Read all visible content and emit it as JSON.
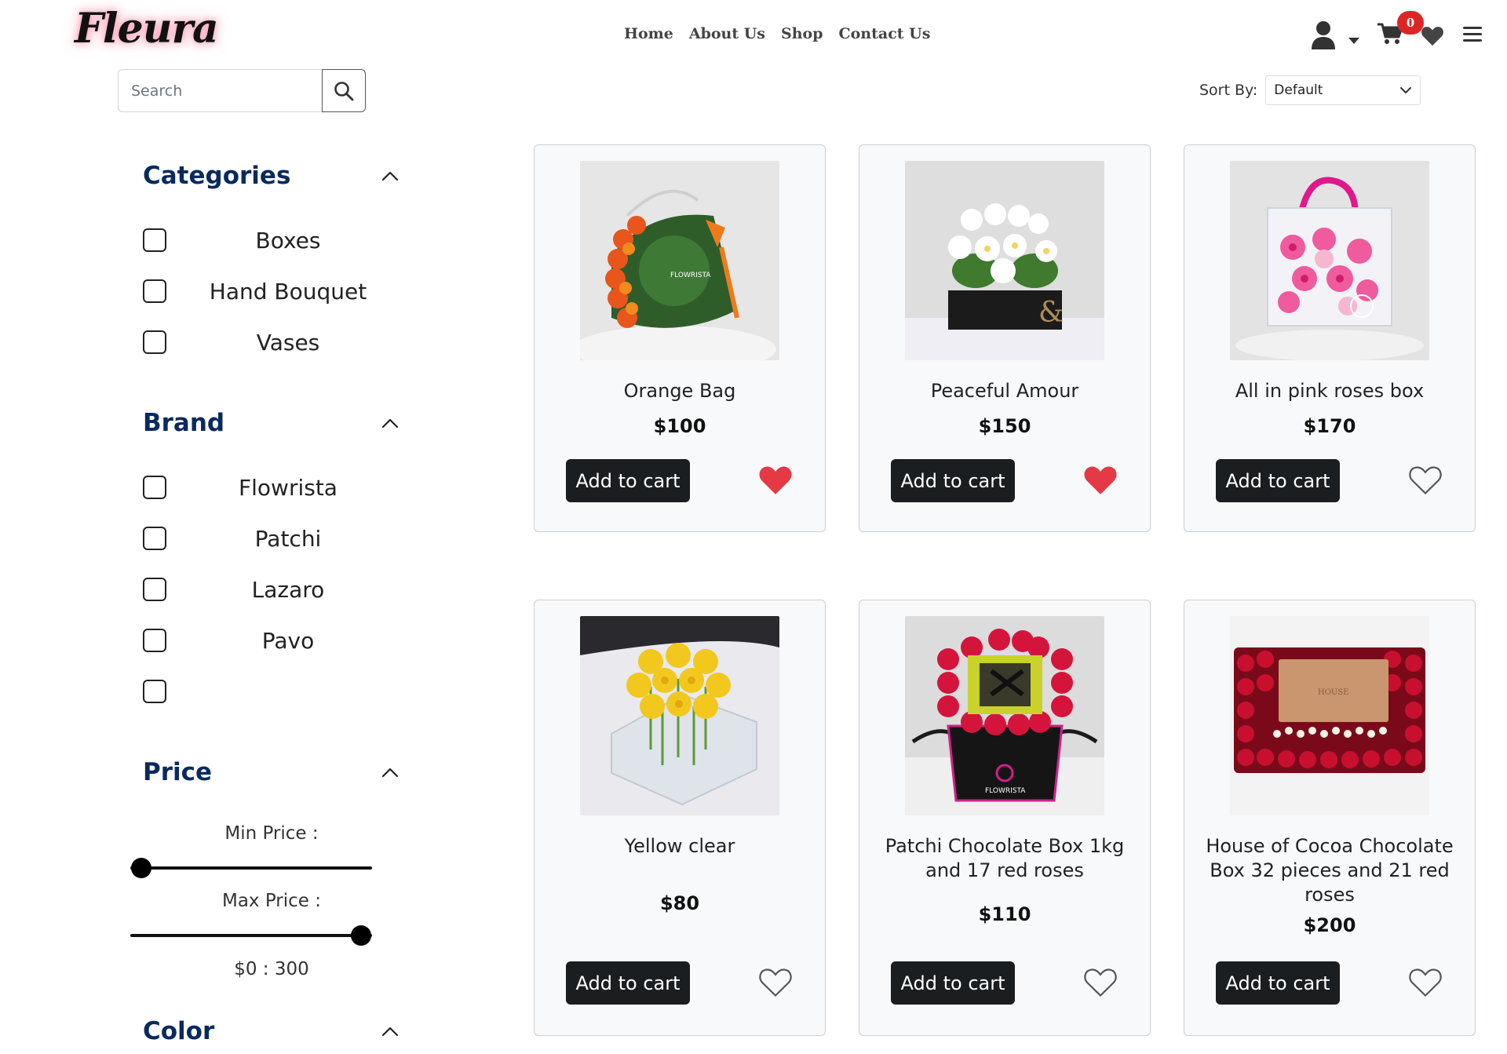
{
  "brand": {
    "logo": "Fleura"
  },
  "nav": [
    "Home",
    "About Us",
    "Shop",
    "Contact Us"
  ],
  "header": {
    "cart_count": "0"
  },
  "search": {
    "placeholder": "Search",
    "value": ""
  },
  "sort": {
    "label": "Sort By:",
    "selected": "Default"
  },
  "filters": {
    "categories": {
      "title": "Categories",
      "items": [
        "Boxes",
        "Hand Bouquet",
        "Vases"
      ]
    },
    "brand": {
      "title": "Brand",
      "items": [
        "Flowrista",
        "Patchi",
        "Lazaro",
        "Pavo",
        ""
      ]
    },
    "price": {
      "title": "Price",
      "min_label": "Min Price :",
      "max_label": "Max Price :",
      "range_text": "$0 : 300",
      "min_value": 0,
      "max_value": 300,
      "max_limit": 300
    },
    "color": {
      "title": "Color"
    }
  },
  "products": [
    {
      "name": "Orange Bag",
      "price": "$100",
      "button": "Add to cart",
      "favorited": true
    },
    {
      "name": "Peaceful Amour",
      "price": "$150",
      "button": "Add to cart",
      "favorited": true
    },
    {
      "name": "All in pink roses box",
      "price": "$170",
      "button": "Add to cart",
      "favorited": false
    },
    {
      "name": "Yellow clear",
      "price": "$80",
      "button": "Add to cart",
      "favorited": false
    },
    {
      "name": "Patchi Chocolate Box 1kg and 17 red roses",
      "price": "$110",
      "button": "Add to cart",
      "favorited": false
    },
    {
      "name": "House of Cocoa Chocolate Box 32 pieces and 21 red roses",
      "price": "$200",
      "button": "Add to cart",
      "favorited": false
    }
  ],
  "colors": {
    "accent_heading": "#0a2a5e",
    "favorite": "#e53945",
    "badge": "#dc2626",
    "button": "#1b1e21"
  }
}
